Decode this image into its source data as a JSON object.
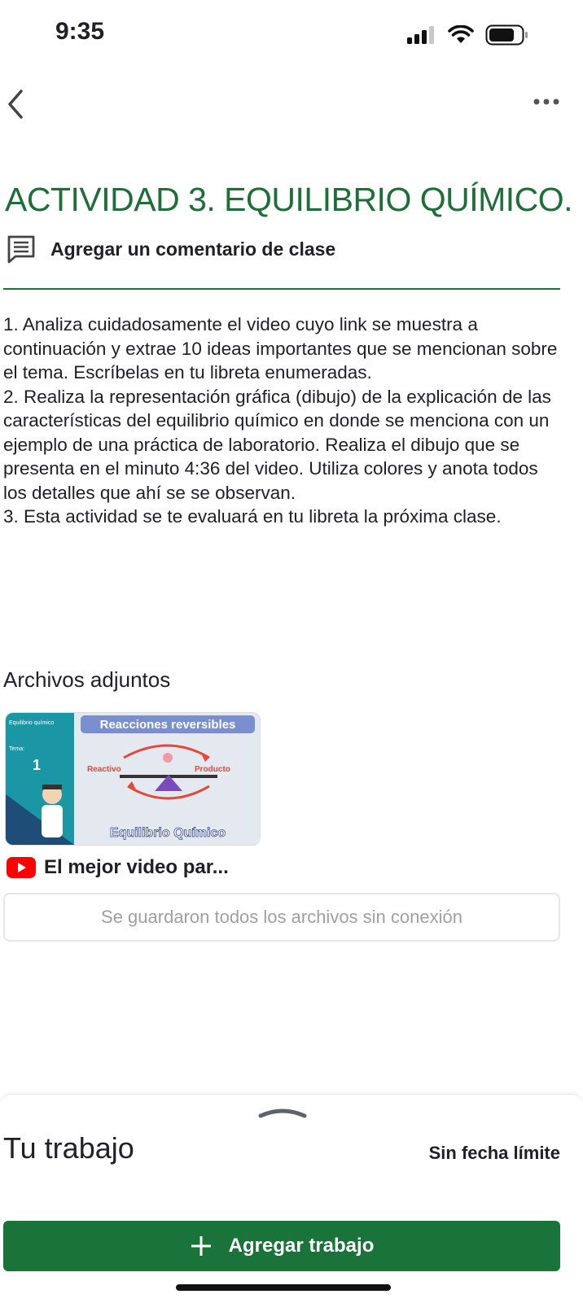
{
  "status_bar": {
    "time": "9:35"
  },
  "colors": {
    "accent": "#1e6e3a",
    "button": "#1a7339",
    "youtube_red": "#ff0000"
  },
  "header": {
    "back_icon": "chevron-left-icon",
    "more_icon": "more-horizontal-icon"
  },
  "assignment": {
    "title": "ACTIVIDAD 3. EQUILIBRIO QUÍMICO.",
    "class_comment_label": "Agregar un comentario de clase",
    "instructions": [
      "1. Analiza cuidadosamente el video cuyo link se muestra a continuación y extrae 10 ideas importantes que se mencionan sobre el tema. Escríbelas en tu libreta enumeradas.",
      "2.  Realiza la representación gráfica (dibujo) de la explicación de las características del equilibrio químico en donde se menciona con un ejemplo de una práctica de laboratorio. Realiza el dibujo que se presenta en el minuto 4:36 del video. Utiliza colores y anota todos los detalles que ahí se se observan.",
      "3. Esta actividad se te evaluará en tu libreta la próxima clase."
    ]
  },
  "attachments": {
    "title": "Archivos adjuntos",
    "thumbnail": {
      "banner": "Reacciones reversibles",
      "side_label": "Equilibrio químico",
      "tema_label": "Tema:",
      "tema_number": "1",
      "left_label": "Reactivo",
      "right_label": "Producto",
      "footer": "Equilibrio Químico"
    },
    "video_label": "El mejor video par...",
    "offline_status": "Se guardaron todos los archivos sin conexión"
  },
  "your_work": {
    "title": "Tu trabajo",
    "due": "Sin fecha límite",
    "add_button_label": "Agregar trabajo"
  }
}
